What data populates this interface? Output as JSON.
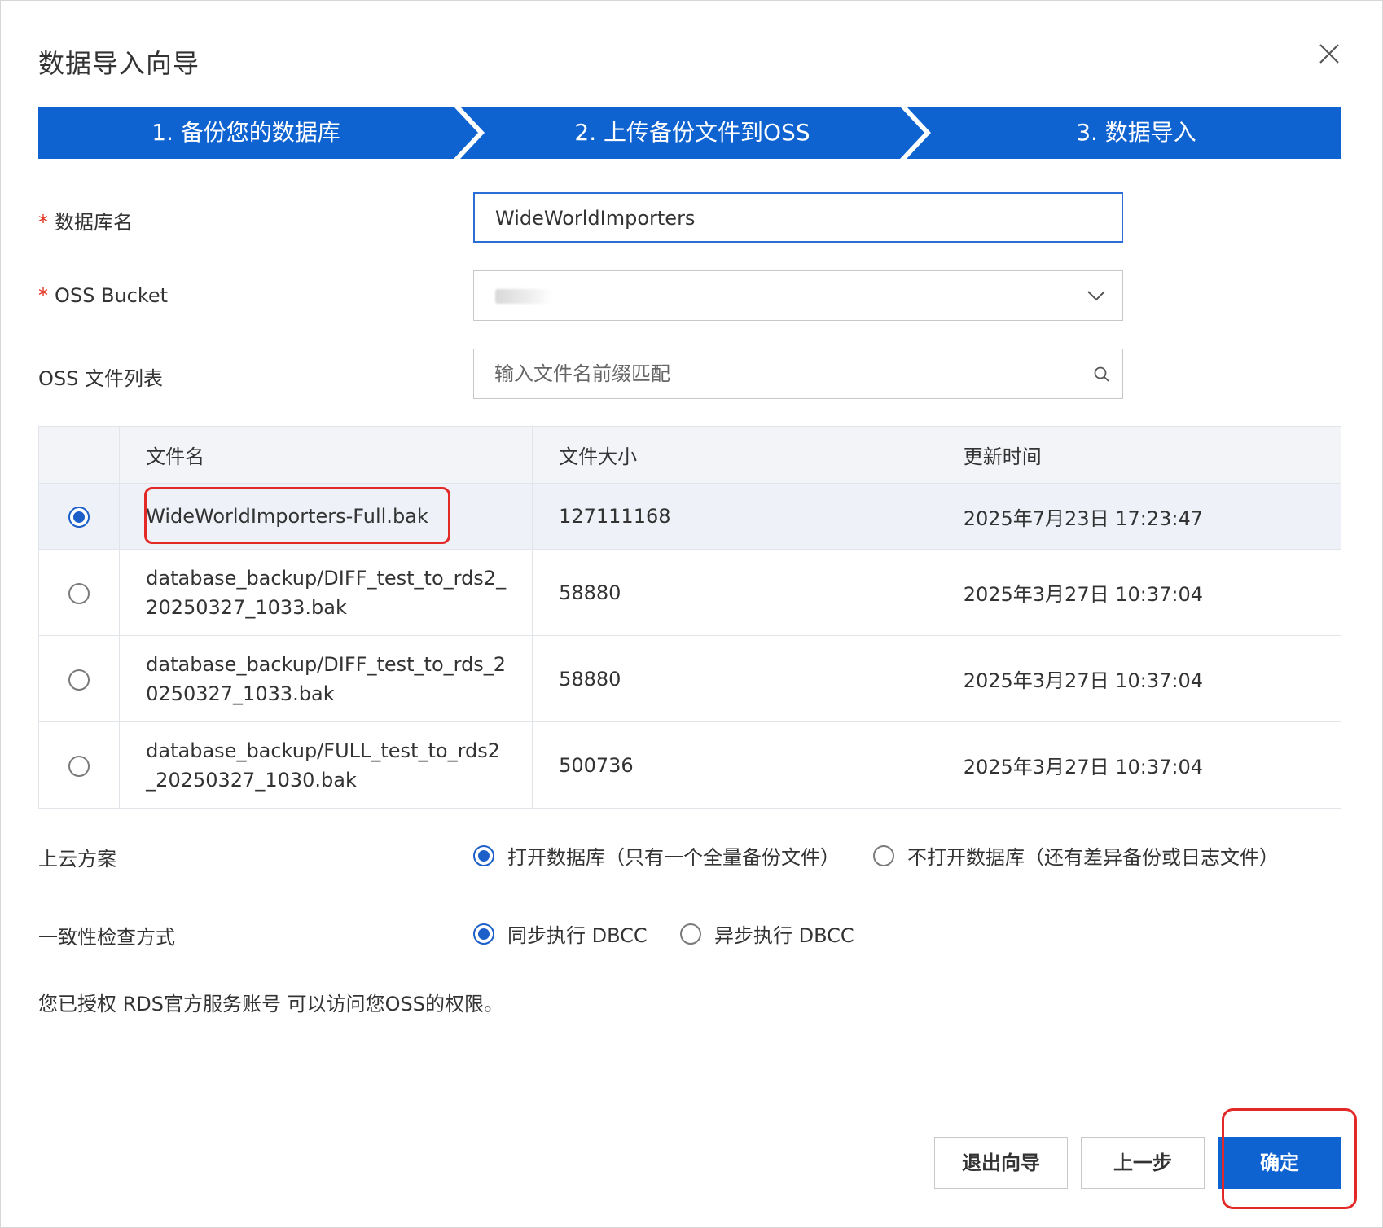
{
  "dialog": {
    "title": "数据导入向导"
  },
  "steps": [
    {
      "label": "1. 备份您的数据库"
    },
    {
      "label": "2. 上传备份文件到OSS"
    },
    {
      "label": "3. 数据导入"
    }
  ],
  "form": {
    "required_mark": "*",
    "db_name": {
      "label": "数据库名",
      "value": "WideWorldImporters"
    },
    "oss_bucket": {
      "label": "OSS Bucket",
      "value": ""
    },
    "oss_files": {
      "label": "OSS 文件列表",
      "placeholder": "输入文件名前缀匹配"
    }
  },
  "table": {
    "headers": [
      "文件名",
      "文件大小",
      "更新时间"
    ],
    "rows": [
      {
        "name": "WideWorldImporters-Full.bak",
        "size": "127111168",
        "time": "2025年7月23日 17:23:47",
        "selected": true
      },
      {
        "name": "database_backup/DIFF_test_to_rds2_\n20250327_1033.bak",
        "size": "58880",
        "time": "2025年3月27日 10:37:04",
        "selected": false
      },
      {
        "name": "database_backup/DIFF_test_to_rds_2\n0250327_1033.bak",
        "size": "58880",
        "time": "2025年3月27日 10:37:04",
        "selected": false
      },
      {
        "name": "database_backup/FULL_test_to_rds2\n_20250327_1030.bak",
        "size": "500736",
        "time": "2025年3月27日 10:37:04",
        "selected": false
      }
    ]
  },
  "cloud_plan": {
    "label": "上云方案",
    "option_open": "打开数据库（只有一个全量备份文件）",
    "option_not_open": "不打开数据库（还有差异备份或日志文件）"
  },
  "consistency": {
    "label": "一致性检查方式",
    "option_sync": "同步执行 DBCC",
    "option_async": "异步执行 DBCC"
  },
  "notice": "您已授权 RDS官方服务账号 可以访问您OSS的权限。",
  "buttons": {
    "exit": "退出向导",
    "prev": "上一步",
    "confirm": "确定"
  },
  "colors": {
    "step_bg": "#0e63d1",
    "primary": "#0e63d1",
    "highlight": "#e32828"
  }
}
